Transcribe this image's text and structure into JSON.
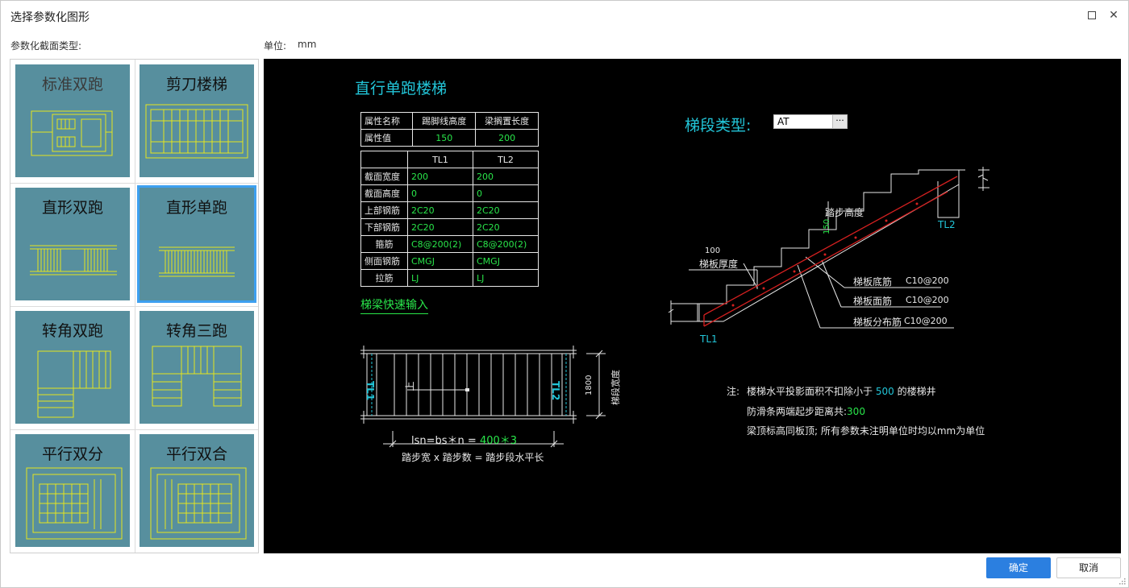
{
  "window": {
    "title": "选择参数化图形"
  },
  "labels": {
    "section_type": "参数化截面类型:",
    "unit_label": "单位:",
    "unit_value": "mm"
  },
  "gallery": {
    "tiles": [
      {
        "name": "标准双跑",
        "selected": false
      },
      {
        "name": "剪刀楼梯",
        "selected": false
      },
      {
        "name": "直形双跑",
        "selected": false
      },
      {
        "name": "直形单跑",
        "selected": true
      },
      {
        "name": "转角双跑",
        "selected": false
      },
      {
        "name": "转角三跑",
        "selected": false
      },
      {
        "name": "平行双分",
        "selected": false
      },
      {
        "name": "平行双合",
        "selected": false
      }
    ]
  },
  "canvas": {
    "title": "直行单跑楼梯",
    "props_table": {
      "header": [
        "属性名称",
        "踢脚线高度",
        "梁搁置长度"
      ],
      "row_label": "属性值",
      "values": [
        "150",
        "200"
      ]
    },
    "beam_table": {
      "columns": [
        "TL1",
        "TL2"
      ],
      "rows": [
        {
          "label": "截面宽度",
          "tl1": "200",
          "tl2": "200"
        },
        {
          "label": "截面高度",
          "tl1": "0",
          "tl2": "0"
        },
        {
          "label": "上部钢筋",
          "tl1": "2C20",
          "tl2": "2C20"
        },
        {
          "label": "下部钢筋",
          "tl1": "2C20",
          "tl2": "2C20"
        },
        {
          "label": "箍筋",
          "tl1": "C8@200(2)",
          "tl2": "C8@200(2)"
        },
        {
          "label": "侧面钢筋",
          "tl1": "CMGJ",
          "tl2": "CMGJ"
        },
        {
          "label": "拉筋",
          "tl1": "LJ",
          "tl2": "LJ"
        }
      ]
    },
    "quick_input_link": "梯梁快速输入",
    "segment_type_label": "梯段类型:",
    "segment_type_value": "AT",
    "segment_type_button": "···",
    "plan": {
      "tl1": "TL1",
      "tl2": "TL2",
      "up": "上",
      "width_dim": "1800",
      "width_label": "梯段宽度",
      "formula_prefix": "lsn=bs＊n = ",
      "formula_values": "400＊3",
      "formula_caption": "踏步宽 x 踏步数 = 踏步段水平长"
    },
    "section": {
      "tl1": "TL1",
      "tl2": "TL2",
      "step_height_label": "踏步高度",
      "step_height_value": "150",
      "slab_thickness_label": "梯板厚度",
      "slab_thickness_value": "100",
      "bottom_bar_label": "梯板底筋",
      "bottom_bar_value": "C10@200",
      "top_bar_label": "梯板面筋",
      "top_bar_value": "C10@200",
      "dist_bar_label": "梯板分布筋",
      "dist_bar_value": "C10@200"
    },
    "notes": {
      "prefix": "注:",
      "line1_a": "楼梯水平投影面积不扣除小于",
      "line1_value": "500",
      "line1_b": "的楼梯井",
      "line2_a": "防滑条两端起步距离共:",
      "line2_value": "300",
      "line3": "梁顶标高同板顶; 所有参数未注明单位时均以mm为单位"
    }
  },
  "buttons": {
    "ok": "确定",
    "cancel": "取消"
  },
  "colors": {
    "accent": "#2b7fe0",
    "tile_bg": "#578f9e",
    "selection": "#3ea0f0",
    "cad_green": "#29e64a",
    "cad_cyan": "#22c5d8",
    "cad_yellow": "#e6e61e",
    "rebar_red": "#d42020"
  }
}
